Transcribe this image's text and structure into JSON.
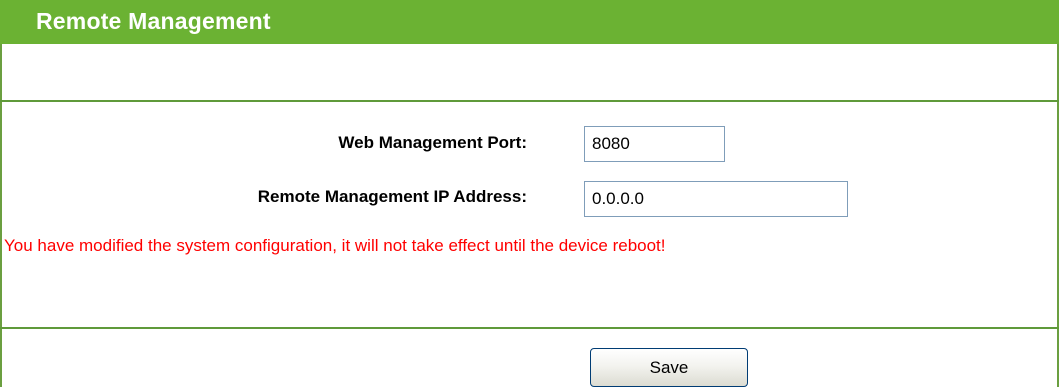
{
  "page": {
    "title": "Remote Management"
  },
  "form": {
    "web_port": {
      "label": "Web Management Port:",
      "value": "8080"
    },
    "remote_ip": {
      "label": "Remote Management IP Address:",
      "value": "0.0.0.0"
    }
  },
  "message": {
    "warning": "You have modified the system configuration, it will not take effect until the device reboot!"
  },
  "actions": {
    "save_label": "Save"
  },
  "colors": {
    "header_green": "#6bb233",
    "divider_green": "#5f9a3a",
    "warning_red": "#ff0000",
    "title_text": "#ffffff"
  }
}
